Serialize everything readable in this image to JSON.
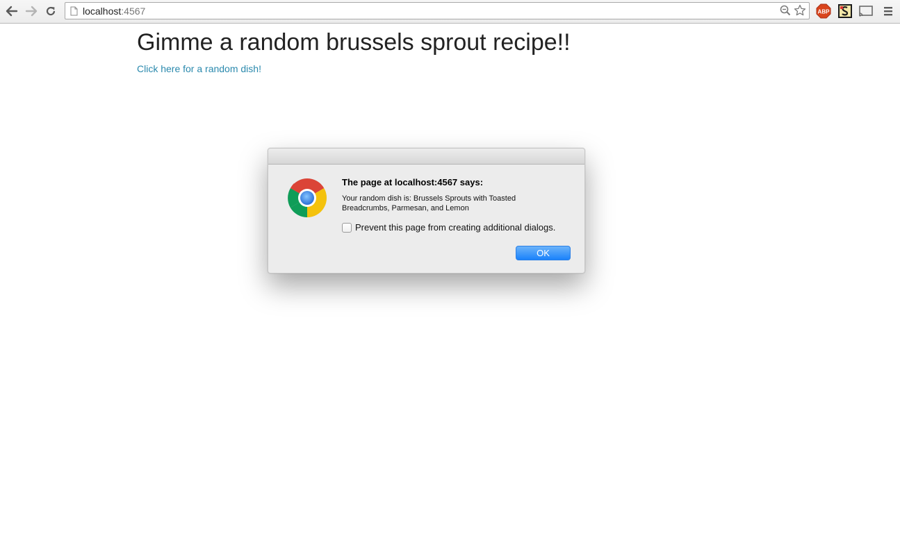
{
  "browser": {
    "url_host": "localhost",
    "url_port": ":4567",
    "icons": [
      "back-arrow-icon",
      "forward-arrow-icon",
      "reload-icon",
      "page-icon",
      "zoom-icon",
      "bookmark-star-icon",
      "adblock-icon",
      "extension-icon",
      "cast-icon",
      "menu-icon"
    ],
    "adblock_label": "ABP"
  },
  "page": {
    "title": "Gimme a random brussels sprout recipe!!",
    "link_text": "Click here for a random dish!",
    "link_color": "#2a89ad"
  },
  "dialog": {
    "heading": "The page at localhost:4567 says:",
    "message": "Your random dish is: Brussels Sprouts with Toasted Breadcrumbs, Parmesan, and Lemon",
    "checkbox_label": "Prevent this page from creating additional dialogs.",
    "checkbox_checked": false,
    "ok_label": "OK",
    "accent_color": "#1a82fb"
  }
}
